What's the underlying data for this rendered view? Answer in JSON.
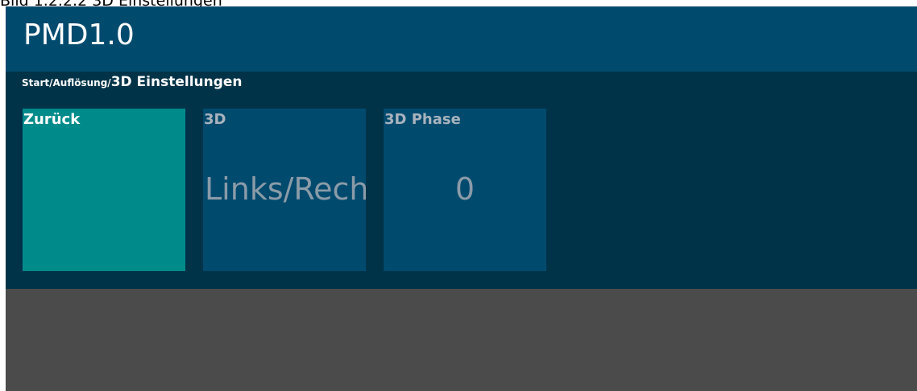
{
  "window": {
    "caption": "Bild 1.2.2.2 3D Einstellungen"
  },
  "header": {
    "title": "PMD1.0"
  },
  "breadcrumb": {
    "path": "Start/Auflösung/",
    "current": "3D Einstellungen"
  },
  "tiles": [
    {
      "label": "Zurück",
      "value": ""
    },
    {
      "label": "3D",
      "value": "Links/Rechts"
    },
    {
      "label": "3D Phase",
      "value": "0"
    }
  ],
  "colors": {
    "header": "#004a6e",
    "content": "#003348",
    "tile": "#004a6e",
    "back_tile": "#008b8b",
    "empty_area": "#4b4b4b"
  }
}
